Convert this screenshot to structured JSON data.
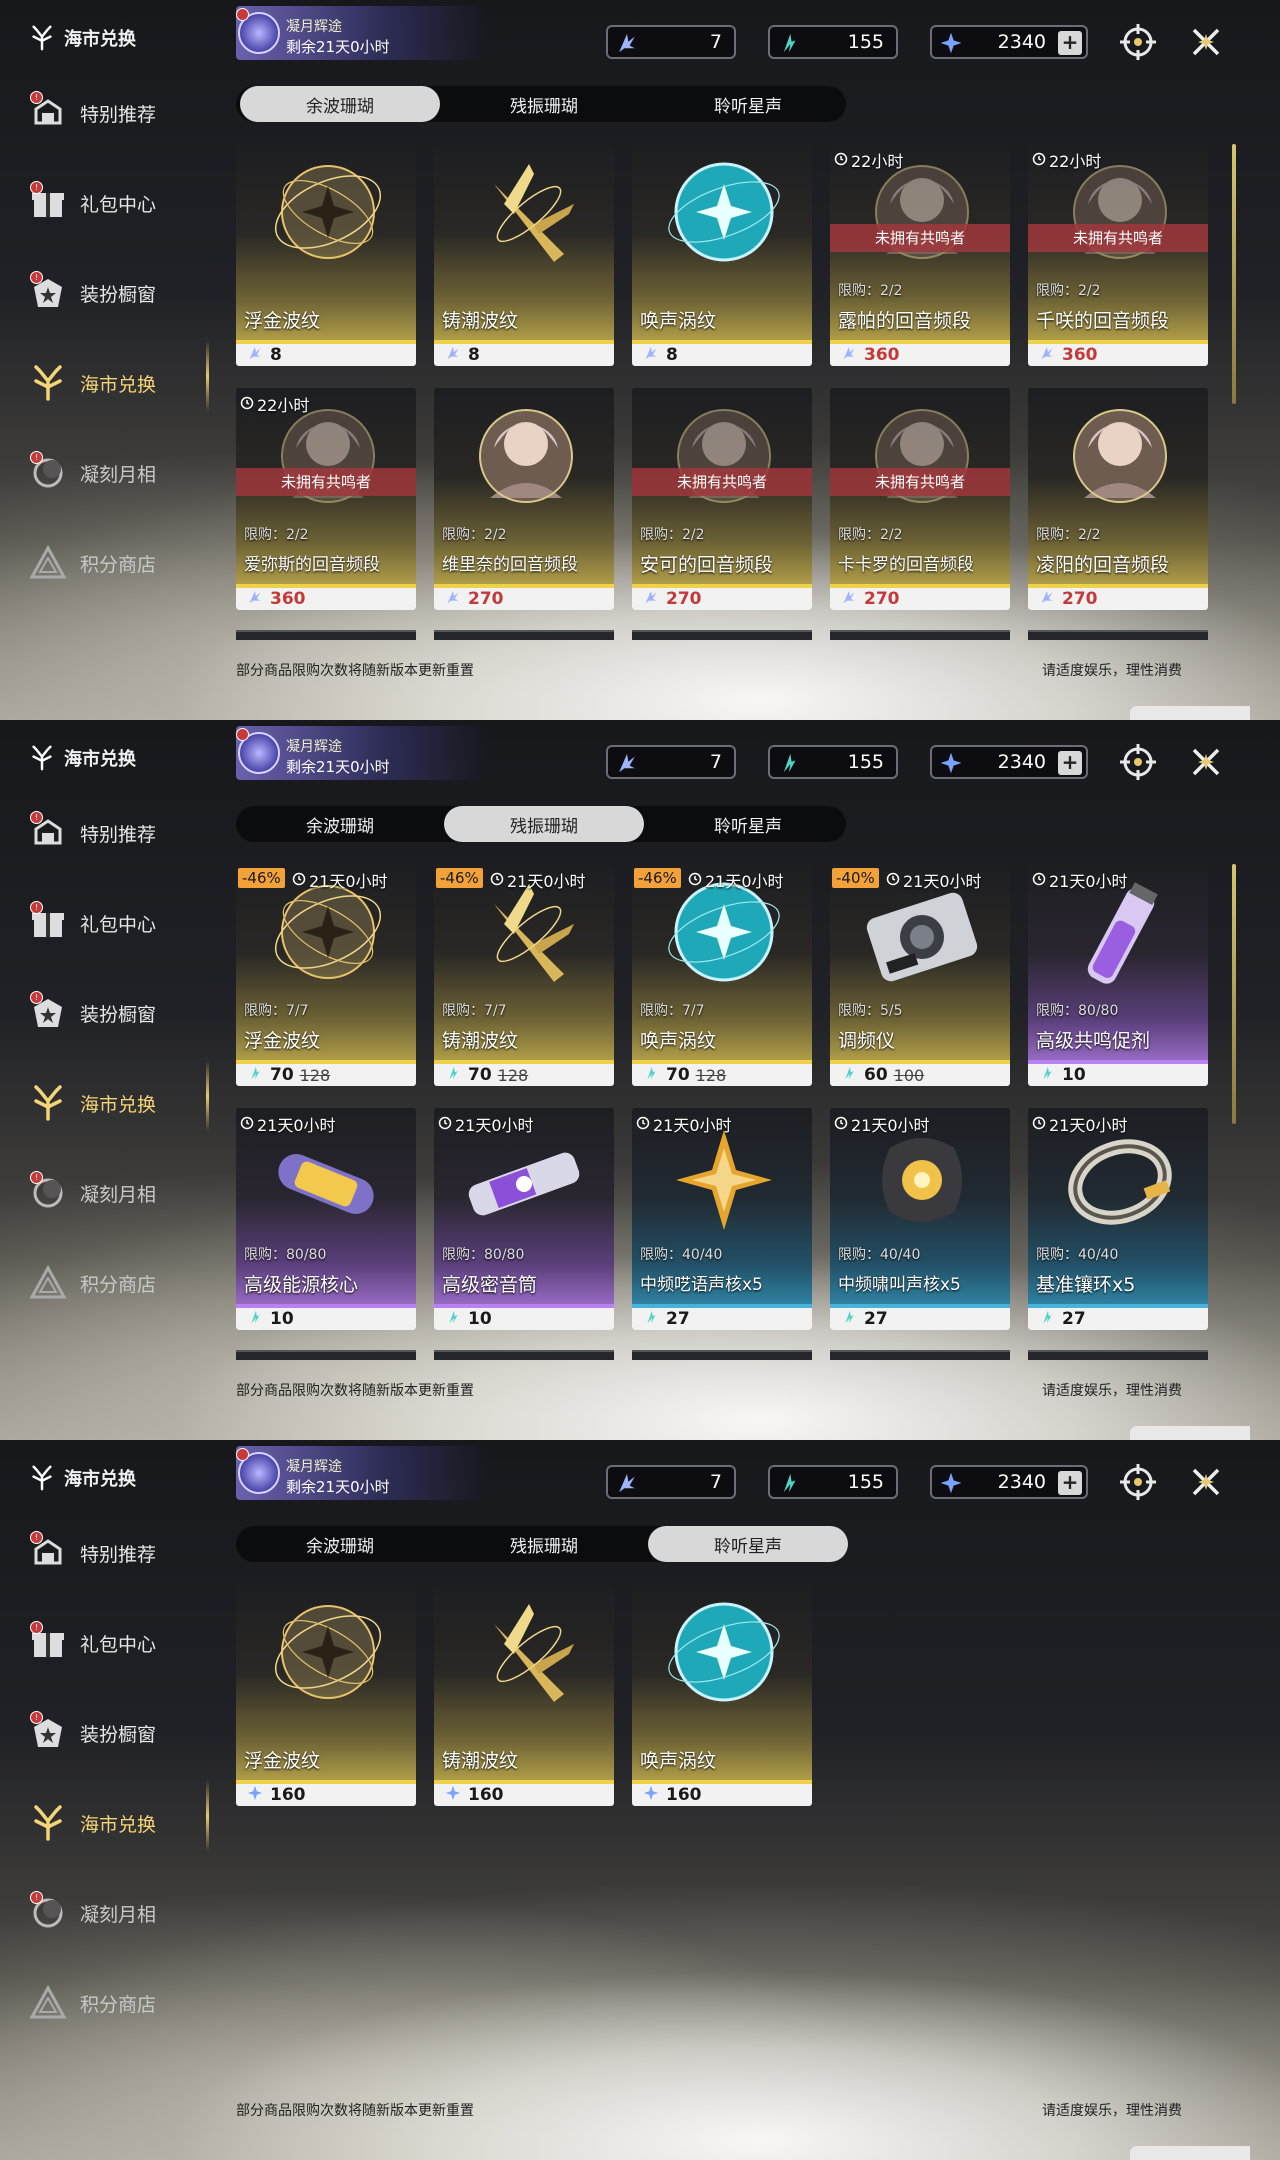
{
  "sidebar": {
    "header": "海市兑换",
    "items": [
      {
        "label": "特别推荐",
        "icon": "recommend-icon",
        "badge": true
      },
      {
        "label": "礼包中心",
        "icon": "gift-icon",
        "badge": true
      },
      {
        "label": "装扮橱窗",
        "icon": "wardrobe-icon",
        "badge": true
      },
      {
        "label": "海市兑换",
        "icon": "coral-icon",
        "badge": false
      },
      {
        "label": "凝刻月相",
        "icon": "moon-icon",
        "badge": true
      },
      {
        "label": "积分商店",
        "icon": "points-icon",
        "badge": false
      }
    ]
  },
  "event": {
    "title": "凝月辉途",
    "remaining": "剩余21天0小时"
  },
  "currency": {
    "afterglow": "7",
    "oscillate": "155",
    "starsound": "2340",
    "plus": "+"
  },
  "tabs": [
    "余波珊瑚",
    "残振珊瑚",
    "聆听星声"
  ],
  "footer": {
    "note": "部分商品限购次数将随新版本更新重置",
    "right": "请适度娱乐，理性消费"
  },
  "colors": {
    "gold": "#f0d24a",
    "purple": "#b880f0",
    "blue": "#47b3dc",
    "discount": "#f3a23a",
    "banner": "#a0373c"
  },
  "panels": [
    {
      "selected_tab": 0,
      "cards": [
        {
          "name": "浮金波纹",
          "price": "8",
          "currency": "afterglow",
          "tone": "gold",
          "art": "gold-orb"
        },
        {
          "name": "铸潮波纹",
          "price": "8",
          "currency": "afterglow",
          "tone": "gold",
          "art": "gold-dagger"
        },
        {
          "name": "唤声涡纹",
          "price": "8",
          "currency": "afterglow",
          "tone": "gold",
          "art": "cyan-orb"
        },
        {
          "name": "露帕的回音频段",
          "price": "360",
          "currency": "afterglow",
          "tone": "gold",
          "art": "portrait",
          "timer": "22小时",
          "banner": "未拥有共鸣者",
          "limit": "限购：2/2",
          "dim": true,
          "red": true
        },
        {
          "name": "千咲的回音频段",
          "price": "360",
          "currency": "afterglow",
          "tone": "gold",
          "art": "portrait",
          "timer": "22小时",
          "banner": "未拥有共鸣者",
          "limit": "限购：2/2",
          "dim": true,
          "red": true
        },
        {
          "name": "爱弥斯的回音频段",
          "price": "360",
          "currency": "afterglow",
          "tone": "gold",
          "art": "portrait",
          "timer": "22小时",
          "banner": "未拥有共鸣者",
          "limit": "限购：2/2",
          "dim": true,
          "red": true
        },
        {
          "name": "维里奈的回音频段",
          "price": "270",
          "currency": "afterglow",
          "tone": "gold",
          "art": "portrait",
          "limit": "限购：2/2",
          "red": true
        },
        {
          "name": "安可的回音频段",
          "price": "270",
          "currency": "afterglow",
          "tone": "gold",
          "art": "portrait",
          "banner": "未拥有共鸣者",
          "limit": "限购：2/2",
          "dim": true,
          "red": true
        },
        {
          "name": "卡卡罗的回音频段",
          "price": "270",
          "currency": "afterglow",
          "tone": "gold",
          "art": "portrait",
          "banner": "未拥有共鸣者",
          "limit": "限购：2/2",
          "dim": true,
          "red": true
        },
        {
          "name": "凌阳的回音频段",
          "price": "270",
          "currency": "afterglow",
          "tone": "gold",
          "art": "portrait",
          "limit": "限购：2/2",
          "red": true
        }
      ]
    },
    {
      "selected_tab": 1,
      "cards": [
        {
          "name": "浮金波纹",
          "price": "70",
          "old": "128",
          "currency": "oscillate",
          "tone": "gold",
          "art": "gold-orb",
          "discount": "-46%",
          "timer": "21天0小时",
          "limit": "限购：7/7"
        },
        {
          "name": "铸潮波纹",
          "price": "70",
          "old": "128",
          "currency": "oscillate",
          "tone": "gold",
          "art": "gold-dagger",
          "discount": "-46%",
          "timer": "21天0小时",
          "limit": "限购：7/7"
        },
        {
          "name": "唤声涡纹",
          "price": "70",
          "old": "128",
          "currency": "oscillate",
          "tone": "gold",
          "art": "cyan-orb",
          "discount": "-46%",
          "timer": "21天0小时",
          "limit": "限购：7/7"
        },
        {
          "name": "调频仪",
          "price": "60",
          "old": "100",
          "currency": "oscillate",
          "tone": "gold",
          "art": "device",
          "discount": "-40%",
          "timer": "21天0小时",
          "limit": "限购：5/5"
        },
        {
          "name": "高级共鸣促剂",
          "price": "10",
          "currency": "oscillate",
          "tone": "purple",
          "art": "vial",
          "timer": "21天0小时",
          "limit": "限购：80/80"
        },
        {
          "name": "高级能源核心",
          "price": "10",
          "currency": "oscillate",
          "tone": "purple",
          "art": "capsule",
          "timer": "21天0小时",
          "limit": "限购：80/80"
        },
        {
          "name": "高级密音筒",
          "price": "10",
          "currency": "oscillate",
          "tone": "purple",
          "art": "tube",
          "timer": "21天0小时",
          "limit": "限购：80/80"
        },
        {
          "name": "中频呓语声核x5",
          "price": "27",
          "currency": "oscillate",
          "tone": "blue",
          "art": "star",
          "timer": "21天0小时",
          "limit": "限购：40/40"
        },
        {
          "name": "中频啸叫声核x5",
          "price": "27",
          "currency": "oscillate",
          "tone": "blue",
          "art": "core",
          "timer": "21天0小时",
          "limit": "限购：40/40"
        },
        {
          "name": "基准镶环x5",
          "price": "27",
          "currency": "oscillate",
          "tone": "blue",
          "art": "ring",
          "timer": "21天0小时",
          "limit": "限购：40/40"
        }
      ]
    },
    {
      "selected_tab": 2,
      "cards": [
        {
          "name": "浮金波纹",
          "price": "160",
          "currency": "starsound",
          "tone": "gold",
          "art": "gold-orb"
        },
        {
          "name": "铸潮波纹",
          "price": "160",
          "currency": "starsound",
          "tone": "gold",
          "art": "gold-dagger"
        },
        {
          "name": "唤声涡纹",
          "price": "160",
          "currency": "starsound",
          "tone": "gold",
          "art": "cyan-orb"
        }
      ]
    }
  ]
}
